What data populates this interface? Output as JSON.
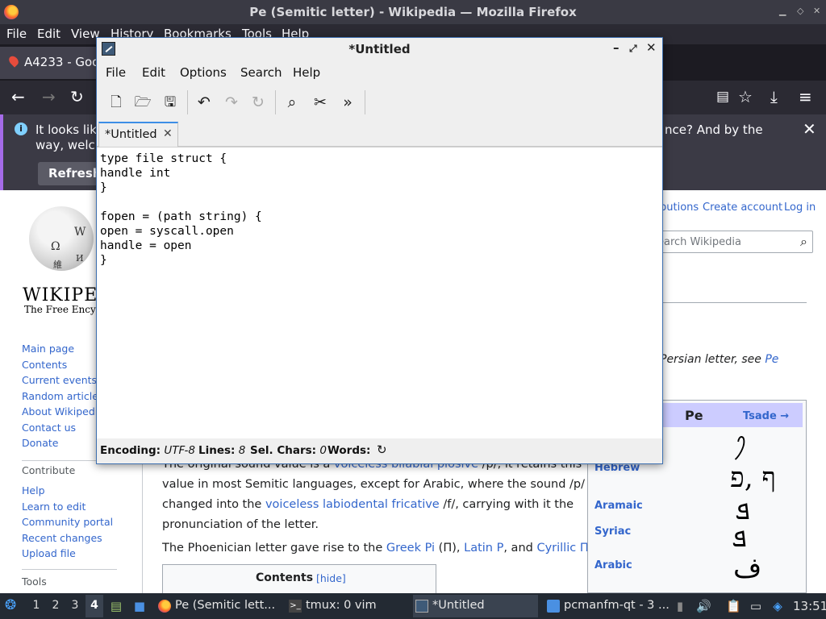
{
  "firefox": {
    "window_title": "Pe (Semitic letter) - Wikipedia — Mozilla Firefox",
    "menu": [
      "File",
      "Edit",
      "View",
      "History",
      "Bookmarks",
      "Tools",
      "Help"
    ],
    "tab_title": "A4233 - Goo",
    "notice": {
      "line1_left": "It looks lik",
      "line2_left": "way, welc",
      "line1_right": "nce? And by the",
      "refresh_label": "Refresh"
    }
  },
  "wikipedia": {
    "wordmark": "WIKIPED",
    "tagline": "The Free Encyclo",
    "top_links": [
      "butions",
      "Create account",
      "Log in"
    ],
    "search_placeholder": "earch Wikipedia",
    "hatnote_text": "Persian letter, see ",
    "hatnote_link": "Pe",
    "sidebar_nav": [
      "Main page",
      "Contents",
      "Current events",
      "Random article",
      "About Wikipedia",
      "Contact us",
      "Donate"
    ],
    "contribute_heading": "Contribute",
    "sidebar_contribute": [
      "Help",
      "Learn to edit",
      "Community portal",
      "Recent changes",
      "Upload file"
    ],
    "tools_heading": "Tools",
    "paragraph1": {
      "l0a": "The original sound value is a ",
      "l0b": "voiceless bilabial plosive",
      "l0c": " /p/, it retains this",
      "l1": "value in most Semitic languages, except for Arabic, where the sound /p/",
      "l2a": "changed into the ",
      "l2b": "voiceless labiodental fricative",
      "l2c": " /f/, carrying with it the",
      "l3": "pronunciation of the letter."
    },
    "paragraph2": {
      "a": "The Phoenician letter gave rise to the ",
      "b": "Greek Pi",
      "c": " (Π), ",
      "d": "Latin P",
      "e": ", and ",
      "f": "Cyrillic П",
      "g": "."
    },
    "toc": {
      "title": "Contents",
      "hide": "[hide]"
    },
    "infobox": {
      "title": "Pe",
      "next": "Tsade →",
      "rows": [
        {
          "lang": "Hebrew",
          "glyph": "ף ,פ"
        },
        {
          "lang": "Aramaic",
          "glyph": "ܦ"
        },
        {
          "lang": "Syriac",
          "glyph": "ܦ"
        },
        {
          "lang": "Arabic",
          "glyph": "ف"
        }
      ],
      "phoenician_glyph": "𐤐"
    }
  },
  "featherpad": {
    "window_title": "*Untitled",
    "menu": [
      "File",
      "Edit",
      "Options",
      "Search",
      "Help"
    ],
    "tab_label": "*Untitled",
    "code": "type file struct {\nhandle int\n}\n\nfopen = (path string) {\nopen = syscall.open\nhandle = open\n}",
    "status": {
      "encoding_label": "Encoding:",
      "encoding_value": "UTF-8",
      "lines_label": "Lines:",
      "lines_value": "8",
      "sel_label": "Sel. Chars:",
      "sel_value": "0",
      "words_label": "Words:"
    }
  },
  "taskbar": {
    "workspaces": [
      "1",
      "2",
      "3",
      "4"
    ],
    "active_workspace": "4",
    "tasks": [
      "Pe (Semitic lett...",
      "tmux: 0 vim",
      "*Untitled",
      "pcmanfm-qt - 3 ..."
    ],
    "clock": "13:51"
  }
}
